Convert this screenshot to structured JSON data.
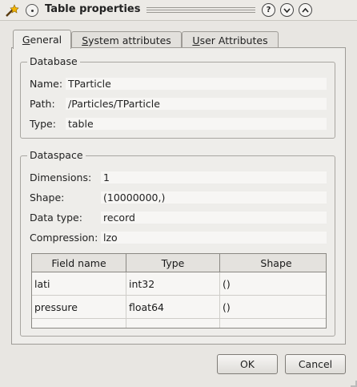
{
  "window": {
    "title": "Table properties",
    "controls": {
      "help": "?",
      "minimize": "⌄",
      "maximize": "⌃"
    }
  },
  "tabs": [
    {
      "label": "General",
      "mnemonic": "G",
      "rest": "eneral",
      "active": true
    },
    {
      "label": "System attributes",
      "mnemonic": "S",
      "rest": "ystem attributes",
      "active": false
    },
    {
      "label": "User Attributes",
      "mnemonic": "U",
      "rest": "ser Attributes",
      "active": false
    }
  ],
  "database": {
    "group_title": "Database",
    "name_label": "Name:",
    "name_value": "TParticle",
    "path_label": "Path:",
    "path_value": "/Particles/TParticle",
    "type_label": "Type:",
    "type_value": "table"
  },
  "dataspace": {
    "group_title": "Dataspace",
    "dimensions_label": "Dimensions:",
    "dimensions_value": "1",
    "shape_label": "Shape:",
    "shape_value": "(10000000,)",
    "datatype_label": "Data type:",
    "datatype_value": "record",
    "compression_label": "Compression:",
    "compression_value": "lzo"
  },
  "fields_table": {
    "headers": [
      "Field name",
      "Type",
      "Shape"
    ],
    "rows": [
      [
        "lati",
        "int32",
        "()"
      ],
      [
        "pressure",
        "float64",
        "()"
      ],
      [
        "",
        "",
        ""
      ]
    ]
  },
  "buttons": {
    "ok": "OK",
    "cancel": "Cancel"
  },
  "icons": {
    "app": "wand-icon",
    "menu": "window-menu-icon",
    "scroll_up": "arrow-up-icon",
    "scroll_down": "arrow-down-icon"
  },
  "colors": {
    "window_bg": "#e8e6e2",
    "panel_bg": "#eeedea",
    "field_bg": "#f7f6f4"
  }
}
